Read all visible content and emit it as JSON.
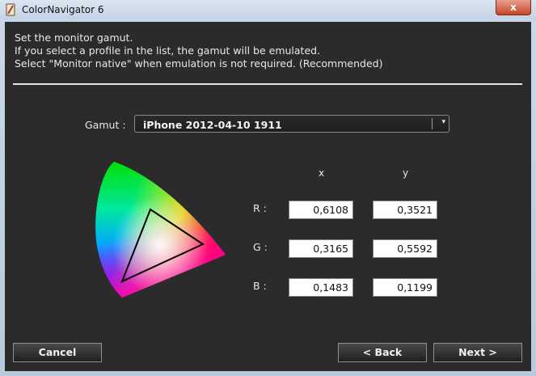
{
  "window": {
    "title": "ColorNavigator 6",
    "close_glyph": "x"
  },
  "instructions": [
    "Set the monitor gamut.",
    "If you select a profile in the list, the gamut will be emulated.",
    "Select \"Monitor native\" when emulation is not required. (Recommended)"
  ],
  "gamut": {
    "label": "Gamut :",
    "selected": "iPhone 2012-04-10 1911",
    "caret": "▾"
  },
  "table": {
    "col_x": "x",
    "col_y": "y",
    "rows": [
      {
        "label": "R :",
        "x": "0,6108",
        "y": "0,3521"
      },
      {
        "label": "G :",
        "x": "0,3165",
        "y": "0,5592"
      },
      {
        "label": "B :",
        "x": "0,1483",
        "y": "0,1199"
      }
    ]
  },
  "buttons": {
    "cancel": "Cancel",
    "back": "< Back",
    "next": "Next >"
  }
}
